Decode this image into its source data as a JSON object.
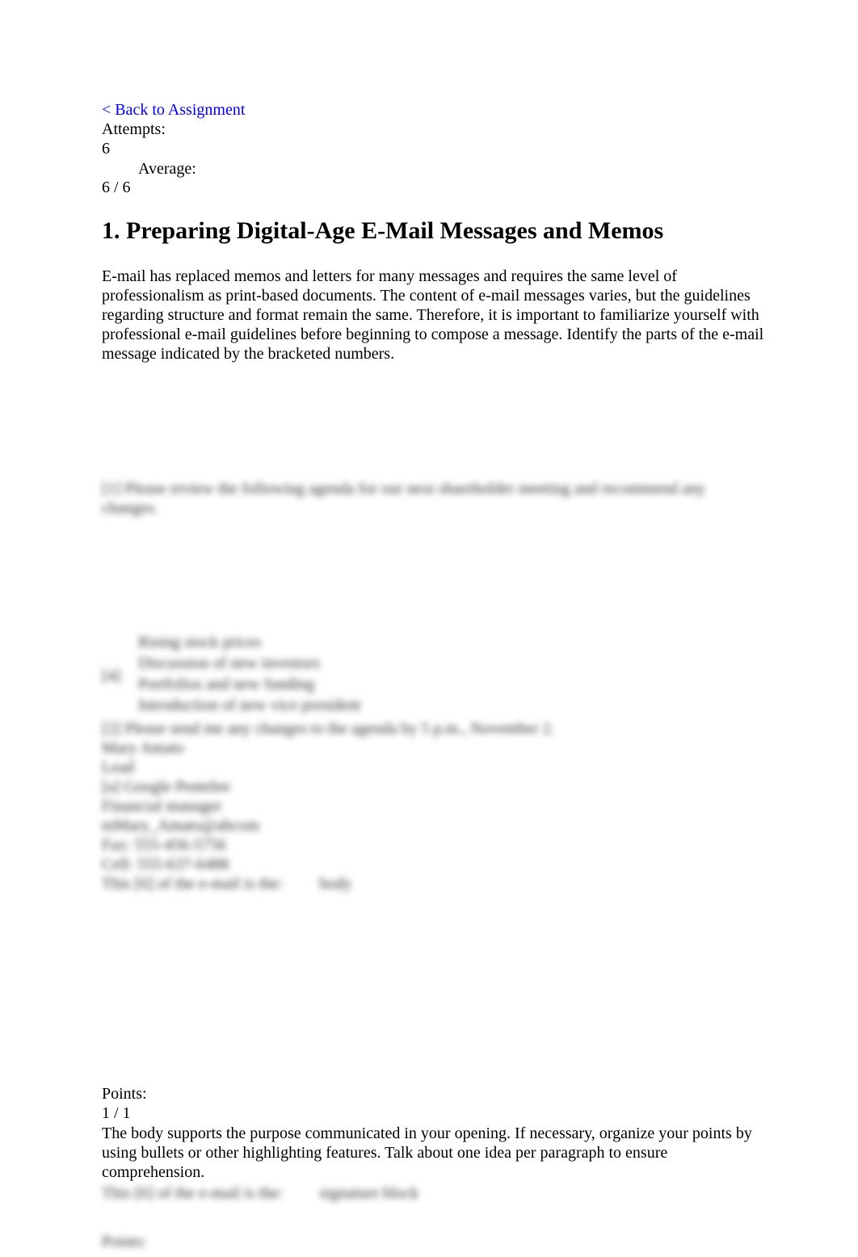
{
  "nav": {
    "back_link": "< Back to Assignment"
  },
  "stats": {
    "attempts_label": "Attempts:",
    "attempts_value": "6",
    "average_label": "Average:",
    "average_value": "6 / 6"
  },
  "question": {
    "title": "1. Preparing Digital-Age E-Mail Messages and Memos",
    "intro": "E-mail has replaced memos and letters for many messages and requires the same level of professionalism as print-based documents. The content of e-mail messages varies, but the guidelines regarding structure and format remain the same. Therefore, it is important to familiarize yourself with professional e-mail guidelines before beginning to compose a message. Identify the parts of the e-mail message indicated by the bracketed numbers."
  },
  "blurred_email": {
    "line1": "[1] Please review the following agenda for our next shareholder meeting and recommend any changes.",
    "marker": "[4]",
    "bullets": [
      "Rising stock prices",
      "Discussion of new investors",
      "Portfolios and new funding",
      "Introduction of new vice president"
    ],
    "line2": "[2] Please send me any changes to the agenda by 5 p.m., November 2.",
    "sig_lines": [
      "Mary Amato",
      "Lead",
      "[a] Google Pentelee",
      "Financial manager",
      "mMary_Amato@abcom",
      "Fax: 555-456-5756",
      "Cell: 555-637-6488"
    ],
    "answer_row": [
      "This [6] of the e-mail is the:",
      "body"
    ]
  },
  "result": {
    "points_label": "Points:",
    "points_value": "1 / 1",
    "feedback": "The body supports the purpose communicated in your opening. If necessary, organize your points by using bullets or other highlighting features. Talk about one idea per paragraph to ensure comprehension.",
    "next_answer_row": [
      "This [6] of the e-mail is the:",
      "signature block"
    ],
    "next_points_label": "Points:"
  }
}
